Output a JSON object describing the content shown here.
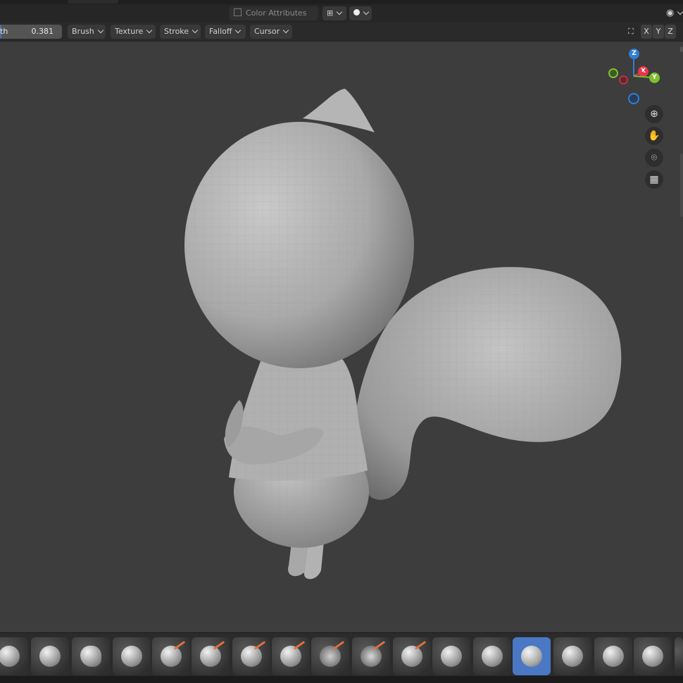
{
  "header": {
    "color_attributes": "Color Attributes"
  },
  "toolbar": {
    "strength_label": "th",
    "strength_value": "0.381",
    "menus": [
      "Brush",
      "Texture",
      "Stroke",
      "Falloff",
      "Cursor"
    ],
    "axes": [
      "X",
      "Y",
      "Z"
    ]
  },
  "gizmo": {
    "z": "Z",
    "x": "X",
    "y": "Y",
    "colors": {
      "x": "#e5364a",
      "y": "#7fbf30",
      "z": "#2f7fd6"
    }
  },
  "nav_icons": [
    "zoom-icon",
    "pan-hand-icon",
    "camera-icon",
    "perspective-grid-icon"
  ],
  "brushes": [
    {
      "name": "draw"
    },
    {
      "name": "draw-sharp"
    },
    {
      "name": "clay"
    },
    {
      "name": "clay-strips"
    },
    {
      "name": "clay-thumb"
    },
    {
      "name": "layer"
    },
    {
      "name": "inflate"
    },
    {
      "name": "blob"
    },
    {
      "name": "crease"
    },
    {
      "name": "smooth"
    },
    {
      "name": "flatten"
    },
    {
      "name": "fill"
    },
    {
      "name": "scrape"
    },
    {
      "name": "multiplane-scrape"
    },
    {
      "name": "pinch"
    },
    {
      "name": "grab",
      "active": true
    },
    {
      "name": "elastic-deform"
    },
    {
      "name": "snake-hook"
    },
    {
      "name": "thumb"
    }
  ],
  "accent_color": "#4a78c4"
}
